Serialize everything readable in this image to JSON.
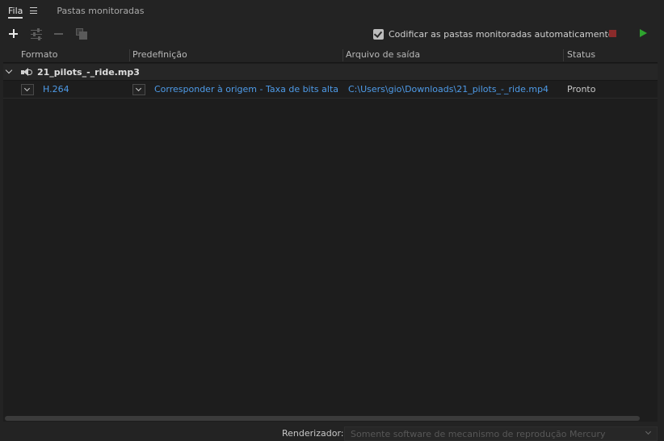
{
  "tabs": {
    "queue": "Fila",
    "watch_folders": "Pastas monitoradas"
  },
  "toolbar": {
    "icons": [
      "plus-icon",
      "settings-icon",
      "minus-icon",
      "duplicate-icon"
    ],
    "auto_encode_label": "Codificar as pastas monitoradas automaticamente",
    "auto_encode_checked": true,
    "stop_color": "#8a2b2b",
    "play_color": "#2ea32e"
  },
  "table": {
    "columns": [
      "Formato",
      "Predefinição",
      "Arquivo de saída",
      "Status"
    ],
    "group": {
      "name": "21_pilots_-_ride.mp3",
      "icon": "speaker-icon",
      "items": [
        {
          "format": "H.264",
          "preset": "Corresponder à origem - Taxa de bits alta",
          "output": "C:\\Users\\gio\\Downloads\\21_pilots_-_ride.mp4",
          "status": "Pronto"
        }
      ]
    }
  },
  "footer": {
    "renderer_label": "Renderizador:",
    "renderer_value": "Somente software de mecanismo de reprodução Mercury"
  },
  "colors": {
    "link": "#4e9be8",
    "background": "#232323"
  }
}
